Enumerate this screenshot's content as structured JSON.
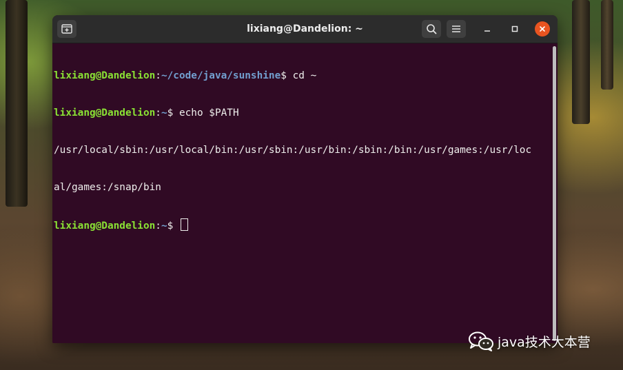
{
  "window": {
    "title": "lixiang@Dandelion: ~"
  },
  "titlebar": {
    "buttons": [
      "new-tab-icon",
      "search-icon",
      "hamburger-menu-icon"
    ],
    "controls": [
      "minimize-icon",
      "maximize-icon",
      "close-icon"
    ]
  },
  "terminal": {
    "lines": [
      {
        "user": "lixiang@Dandelion",
        "sep": ":",
        "path": "~/code/java/sunshine",
        "prompt": "$ ",
        "command": "cd ~"
      },
      {
        "user": "lixiang@Dandelion",
        "sep": ":",
        "path": "~",
        "prompt": "$ ",
        "command": "echo $PATH"
      },
      {
        "output": "/usr/local/sbin:/usr/local/bin:/usr/sbin:/usr/bin:/sbin:/bin:/usr/games:/usr/loc"
      },
      {
        "output": "al/games:/snap/bin"
      },
      {
        "user": "lixiang@Dandelion",
        "sep": ":",
        "path": "~",
        "prompt": "$ ",
        "command": ""
      }
    ]
  },
  "watermark": {
    "text": "java技术大本营",
    "icon": "wechat-icon"
  },
  "colors": {
    "terminal_bg": "#300a24",
    "titlebar_bg": "#2c2c2c",
    "user": "#8ae234",
    "path": "#729fcf",
    "close": "#e95420"
  }
}
